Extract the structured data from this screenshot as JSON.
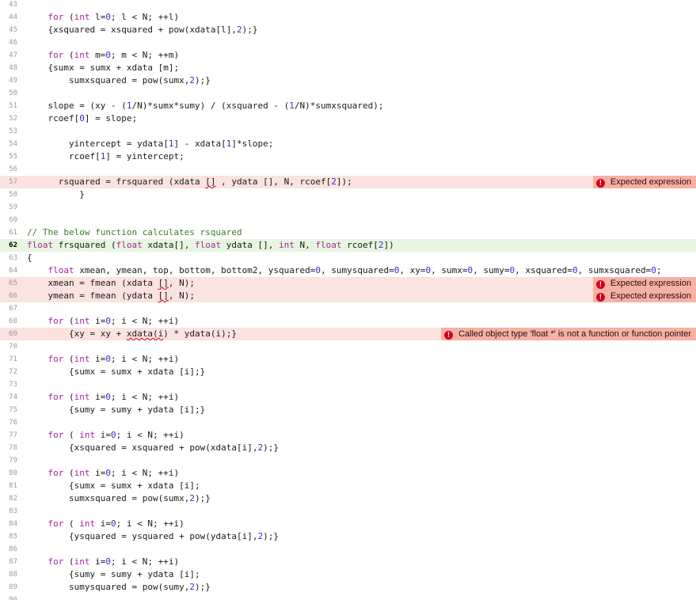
{
  "editor": {
    "lines": [
      {
        "n": "43",
        "text": "",
        "status": ""
      },
      {
        "n": "44",
        "text": "    for (int l=0; l < N; ++l)",
        "status": ""
      },
      {
        "n": "45",
        "text": "    {xsquared = xsquared + pow(xdata[l],2);}",
        "status": ""
      },
      {
        "n": "46",
        "text": "",
        "status": ""
      },
      {
        "n": "47",
        "text": "    for (int m=0; m < N; ++m)",
        "status": ""
      },
      {
        "n": "48",
        "text": "    {sumx = sumx + xdata [m];",
        "status": ""
      },
      {
        "n": "49",
        "text": "        sumxsquared = pow(sumx,2);}",
        "status": ""
      },
      {
        "n": "50",
        "text": "",
        "status": ""
      },
      {
        "n": "51",
        "text": "    slope = (xy - (1/N)*sumx*sumy) / (xsquared - (1/N)*sumxsquared);",
        "status": ""
      },
      {
        "n": "52",
        "text": "    rcoef[0] = slope;",
        "status": ""
      },
      {
        "n": "53",
        "text": "",
        "status": ""
      },
      {
        "n": "54",
        "text": "        yintercept = ydata[1] - xdata[1]*slope;",
        "status": ""
      },
      {
        "n": "55",
        "text": "        rcoef[1] = yintercept;",
        "status": ""
      },
      {
        "n": "56",
        "text": "",
        "status": ""
      },
      {
        "n": "57",
        "text": "      rsquared = frsquared (xdata [] , ydata [], N, rcoef[2]);",
        "status": "error",
        "message": "Expected expression"
      },
      {
        "n": "58",
        "text": "          }",
        "status": ""
      },
      {
        "n": "59",
        "text": "",
        "status": ""
      },
      {
        "n": "60",
        "text": "",
        "status": ""
      },
      {
        "n": "61",
        "text": "// The below function calculates rsquared",
        "status": ""
      },
      {
        "n": "62",
        "text": "float frsquared (float xdata[], float ydata [], int N, float rcoef[2])",
        "status": "current"
      },
      {
        "n": "63",
        "text": "{",
        "status": ""
      },
      {
        "n": "64",
        "text": "    float xmean, ymean, top, bottom, bottom2, ysquared=0, sumysquared=0, xy=0, sumx=0, sumy=0, xsquared=0, sumxsquared=0;",
        "status": ""
      },
      {
        "n": "65",
        "text": "    xmean = fmean (xdata [], N);",
        "status": "error",
        "message": "Expected expression"
      },
      {
        "n": "66",
        "text": "    ymean = fmean (ydata [], N);",
        "status": "error",
        "message": "Expected expression"
      },
      {
        "n": "67",
        "text": "",
        "status": ""
      },
      {
        "n": "68",
        "text": "    for (int i=0; i < N; ++i)",
        "status": ""
      },
      {
        "n": "69",
        "text": "        {xy = xy + xdata(i) * ydata(i);}",
        "status": "error",
        "message": "Called object type 'float *' is not a function or function pointer"
      },
      {
        "n": "70",
        "text": "",
        "status": ""
      },
      {
        "n": "71",
        "text": "    for (int i=0; i < N; ++i)",
        "status": ""
      },
      {
        "n": "72",
        "text": "        {sumx = sumx + xdata [i];}",
        "status": ""
      },
      {
        "n": "73",
        "text": "",
        "status": ""
      },
      {
        "n": "74",
        "text": "    for (int i=0; i < N; ++i)",
        "status": ""
      },
      {
        "n": "75",
        "text": "        {sumy = sumy + ydata [i];}",
        "status": ""
      },
      {
        "n": "76",
        "text": "",
        "status": ""
      },
      {
        "n": "77",
        "text": "    for ( int i=0; i < N; ++i)",
        "status": ""
      },
      {
        "n": "78",
        "text": "        {xsquared = xsquared + pow(xdata[i],2);}",
        "status": ""
      },
      {
        "n": "79",
        "text": "",
        "status": ""
      },
      {
        "n": "80",
        "text": "    for (int i=0; i < N; ++i)",
        "status": ""
      },
      {
        "n": "81",
        "text": "        {sumx = sumx + xdata [i];",
        "status": ""
      },
      {
        "n": "82",
        "text": "        sumxsquared = pow(sumx,2);}",
        "status": ""
      },
      {
        "n": "83",
        "text": "",
        "status": ""
      },
      {
        "n": "84",
        "text": "    for ( int i=0; i < N; ++i)",
        "status": ""
      },
      {
        "n": "85",
        "text": "        {ysquared = ysquared + pow(ydata[i],2);}",
        "status": ""
      },
      {
        "n": "86",
        "text": "",
        "status": ""
      },
      {
        "n": "87",
        "text": "    for (int i=0; i < N; ++i)",
        "status": ""
      },
      {
        "n": "88",
        "text": "        {sumy = sumy + ydata [i];",
        "status": ""
      },
      {
        "n": "89",
        "text": "        sumysquared = pow(sumy,2);}",
        "status": ""
      },
      {
        "n": "90",
        "text": "",
        "status": ""
      }
    ]
  },
  "colors": {
    "error_line_bg": "#fbe3df",
    "error_message_bg": "#f6b1a5",
    "error_icon": "#d0021b",
    "current_line_bg": "#e7f6e1",
    "keyword": "#a6249d",
    "number": "#2d32d0",
    "comment": "#3d7b2f"
  },
  "icons": {
    "error": "error-circle-icon"
  }
}
